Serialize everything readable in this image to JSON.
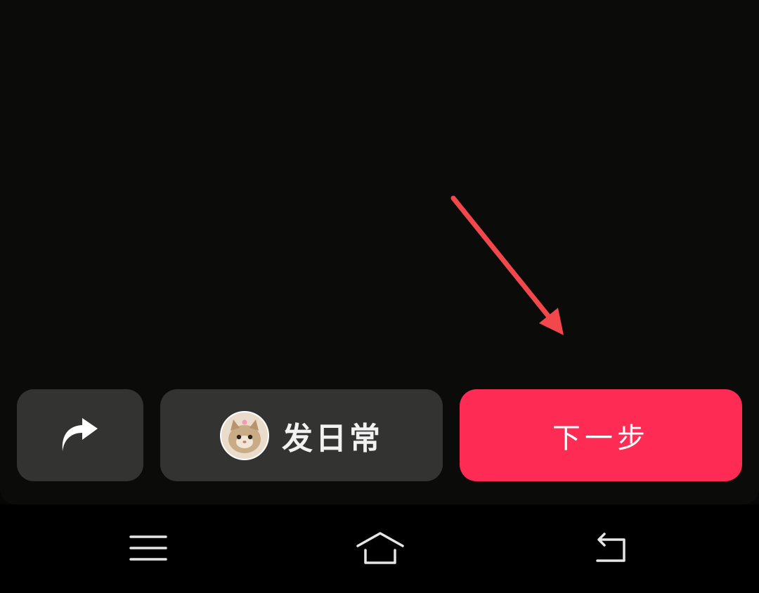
{
  "actions": {
    "share_icon": "share-arrow-icon",
    "daily_label": "发日常",
    "next_label": "下一步"
  },
  "colors": {
    "background": "#050605",
    "button_dark": "#333432",
    "accent": "#fe2c55",
    "annotation_arrow": "#f2474b"
  },
  "nav": {
    "items": [
      "menu-icon",
      "home-icon",
      "back-icon"
    ]
  }
}
